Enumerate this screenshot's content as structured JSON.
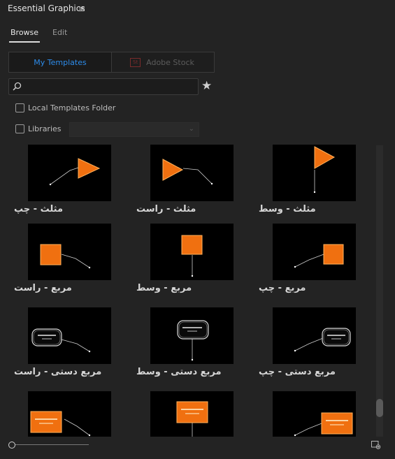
{
  "panel": {
    "title": "Essential Graphics",
    "menu_icon": "≡"
  },
  "tabs": [
    {
      "label": "Browse",
      "active": true
    },
    {
      "label": "Edit",
      "active": false
    }
  ],
  "source_toggle": {
    "my_templates": "My Templates",
    "adobe_stock": "Adobe Stock",
    "stock_badge": "St"
  },
  "search": {
    "value": "",
    "placeholder": ""
  },
  "filters": {
    "local_templates_folder": {
      "label": "Local Templates Folder",
      "checked": false
    },
    "libraries": {
      "label": "Libraries",
      "checked": false,
      "selected": ""
    }
  },
  "templates": [
    {
      "name": "مثلث - چپ"
    },
    {
      "name": "مثلث - راست"
    },
    {
      "name": "مثلث - وسط"
    },
    {
      "name": "مربع - راست"
    },
    {
      "name": "مربع - وسط"
    },
    {
      "name": "مربع - چپ"
    },
    {
      "name": "مربع دستی - راست"
    },
    {
      "name": "مربع دستی - وسط"
    },
    {
      "name": "مربع دستی - چپ"
    },
    {
      "name": ""
    },
    {
      "name": ""
    },
    {
      "name": ""
    }
  ],
  "colors": {
    "accent": "#2d8ceb",
    "background": "#232323",
    "thumbnail_bg": "#000000",
    "shape_orange": "#f07010"
  }
}
